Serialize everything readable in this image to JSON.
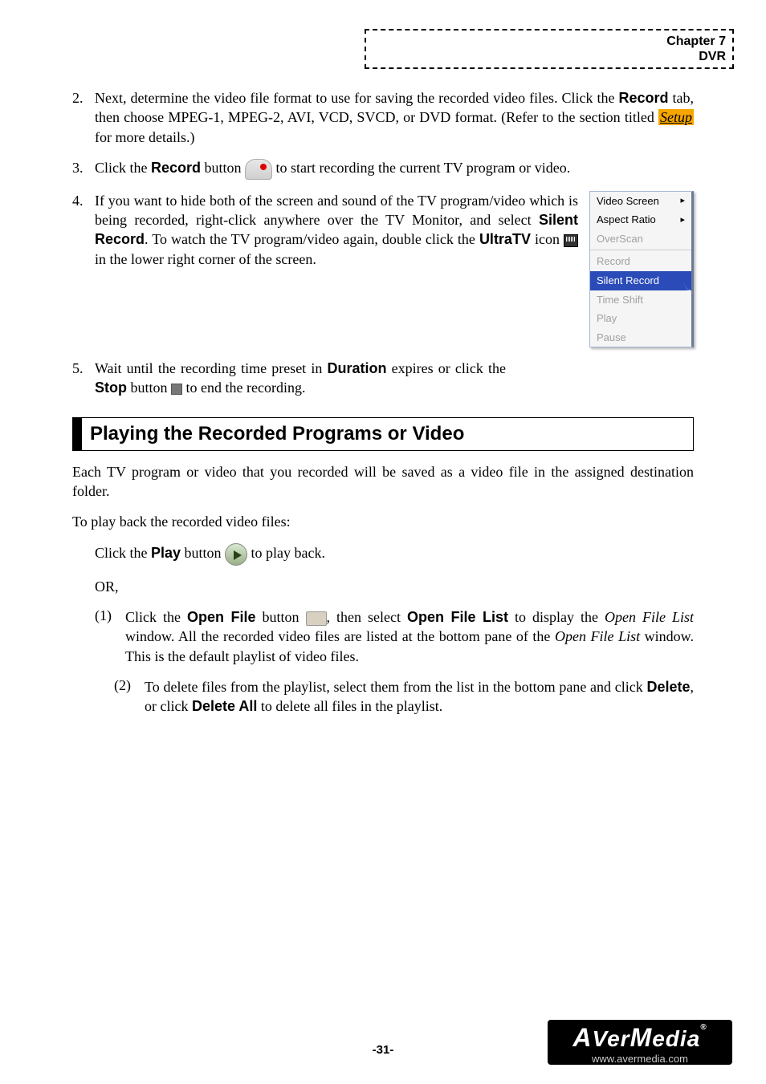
{
  "header": {
    "line1": "Chapter 7",
    "line2": "DVR"
  },
  "items": {
    "2": {
      "num": "2.",
      "text_a": "Next, determine the video file format to use for saving the recorded video files. Click the ",
      "record": "Record",
      "text_b": " tab, then choose MPEG-1, MPEG-2, AVI, VCD, SVCD, or DVD format. (Refer to the section titled ",
      "setup": "Setup",
      "text_c": " for more details.)"
    },
    "3": {
      "num": "3.",
      "text_a": "Click the ",
      "record": "Record",
      "text_b": " button ",
      "text_c": " to start recording the current TV program or video."
    },
    "4": {
      "num": "4.",
      "text_a": "If you want to hide both of the screen and sound of the TV program/video which is being recorded, right-click anywhere over the TV Monitor, and select ",
      "silent": "Silent Record",
      "text_b": ". To watch the TV program/video again, double click the ",
      "ultratv": "UltraTV",
      "text_c": " icon ",
      "text_d": " in the lower right corner of the screen."
    },
    "5": {
      "num": "5.",
      "text_a": "Wait until the recording time preset in ",
      "duration": "Duration",
      "text_b": " expires or click the ",
      "stop": "Stop",
      "text_c": " button ",
      "text_d": " to end the recording."
    }
  },
  "ctx": {
    "video_screen": "Video Screen",
    "aspect_ratio": "Aspect Ratio",
    "overscan": "OverScan",
    "record": "Record",
    "silent_record": "Silent Record",
    "time_shift": "Time Shift",
    "play": "Play",
    "pause": "Pause"
  },
  "section_title": "Playing the Recorded Programs or Video",
  "para1": "Each TV program or video that you recorded will be saved as a video file in the assigned destination folder.",
  "para2": "To play back the recorded video files:",
  "play_line": {
    "a": "Click the ",
    "play": "Play",
    "b": " button ",
    "c": " to play back."
  },
  "or": "OR,",
  "sub": {
    "1": {
      "n": "(1)",
      "a": "Click the ",
      "openfile": "Open File",
      "b": " button ",
      "c": ", then select ",
      "openlist": "Open File List",
      "d": " to display the ",
      "oflw1": "Open File List",
      "e": " window. All the recorded video files are listed at the bottom pane of the ",
      "oflw2": "Open File List",
      "f": " window. This is the default playlist of video files."
    },
    "2": {
      "n": "(2)",
      "a": "To delete files from the playlist, select them from the list in the bottom pane and click ",
      "delete": "Delete",
      "b": ", or click ",
      "deleteall": "Delete All",
      "c": " to delete all files in the playlist."
    }
  },
  "footer": {
    "brand_prefix": "A",
    "brand_mid": "Ver",
    "brand_end": "Media",
    "url": "www.avermedia.com"
  },
  "page_num": "-31-"
}
